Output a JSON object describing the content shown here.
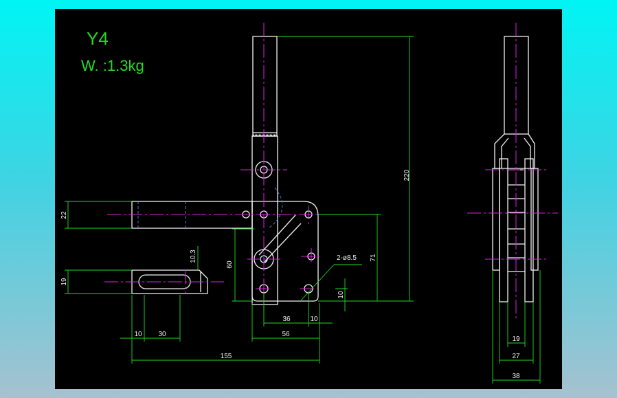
{
  "title": "Y4",
  "weight": "W. :1.3kg",
  "dimensions": {
    "d220": "220",
    "d22": "22",
    "d60": "60",
    "d71": "71",
    "d19": "19",
    "d10_3": "10.3",
    "hole": "2-ø8.5",
    "d10v": "10",
    "d36": "36",
    "d10h": "10",
    "d56": "56",
    "d10a": "10",
    "d30": "30",
    "d155": "155",
    "s19": "19",
    "s27": "27",
    "s38": "38"
  },
  "colors": {
    "background_top": "#00f4f4",
    "canvas": "#000000",
    "geometry": "#f2f2f2",
    "centerline": "#e21ee2",
    "dimension": "#22dd22",
    "hidden": "#3a7fd8"
  }
}
